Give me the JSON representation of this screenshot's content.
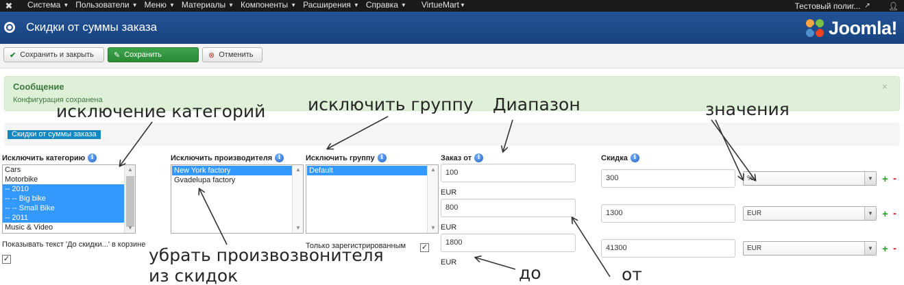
{
  "navbar": {
    "logo_icon": "joomla-icon",
    "menu": [
      "Система",
      "Пользователи",
      "Меню",
      "Материалы",
      "Компоненты",
      "Расширения",
      "Справка",
      "VirtueMart"
    ],
    "site_link": "Тестовый полиг...",
    "user_icon": "user-icon"
  },
  "header": {
    "title": "Скидки от суммы заказа",
    "brand": "Joomla!"
  },
  "toolbar": {
    "save_close": "Сохранить и закрыть",
    "save": "Сохранить",
    "cancel": "Отменить"
  },
  "message": {
    "title": "Сообщение",
    "text": "Конфигурация сохранена",
    "close": "×"
  },
  "section_tab": "Скидки от суммы заказа",
  "exclude_category": {
    "label": "Исключить категорию",
    "options": [
      {
        "text": "Cars",
        "selected": false
      },
      {
        "text": "Motorbike",
        "selected": false
      },
      {
        "text": "-- 2010",
        "selected": true
      },
      {
        "text": "-- -- Big bike",
        "selected": true
      },
      {
        "text": "-- -- Small Bike",
        "selected": true
      },
      {
        "text": "-- 2011",
        "selected": true
      },
      {
        "text": "Music & Video",
        "selected": false
      }
    ]
  },
  "exclude_manufacturer": {
    "label": "Исключить производителя",
    "options": [
      {
        "text": "New York factory",
        "selected": true
      },
      {
        "text": "Gvadelupa factory",
        "selected": false
      }
    ]
  },
  "exclude_group": {
    "label": "Исключить группу",
    "options": [
      {
        "text": "Default",
        "selected": true
      }
    ]
  },
  "show_text": {
    "label": "Показывать текст 'До скидки...' в корзине",
    "checked": true,
    "mark": "✓"
  },
  "only_registered": {
    "label": "Только зарегистрированным",
    "checked": true,
    "mark": "✓"
  },
  "order_from": {
    "label": "Заказ от",
    "rows": [
      {
        "value": "100",
        "currency": "EUR"
      },
      {
        "value": "800",
        "currency": "EUR"
      },
      {
        "value": "1800",
        "currency": "EUR"
      }
    ]
  },
  "discount": {
    "label": "Скидка",
    "rows": [
      {
        "value": "300",
        "type": "%"
      },
      {
        "value": "1300",
        "type": "EUR"
      },
      {
        "value": "41300",
        "type": "EUR"
      }
    ],
    "add": "+",
    "remove": "-"
  },
  "annotations": {
    "categories": "исключение категорий",
    "group": "исключить группу",
    "range": "Диапазон",
    "values": "значения",
    "manufacturer_line1": "убрать произвозвонителя",
    "manufacturer_line2": "из скидок",
    "to": "до",
    "from": "от"
  },
  "colors": {
    "navbar": "#1a1a1a",
    "header": "#1d4a8b",
    "success_bg": "#dff0d8",
    "success_text": "#3c763d",
    "selection": "#3399ff",
    "tab": "#1487be",
    "save_green": "#2a8a36"
  }
}
